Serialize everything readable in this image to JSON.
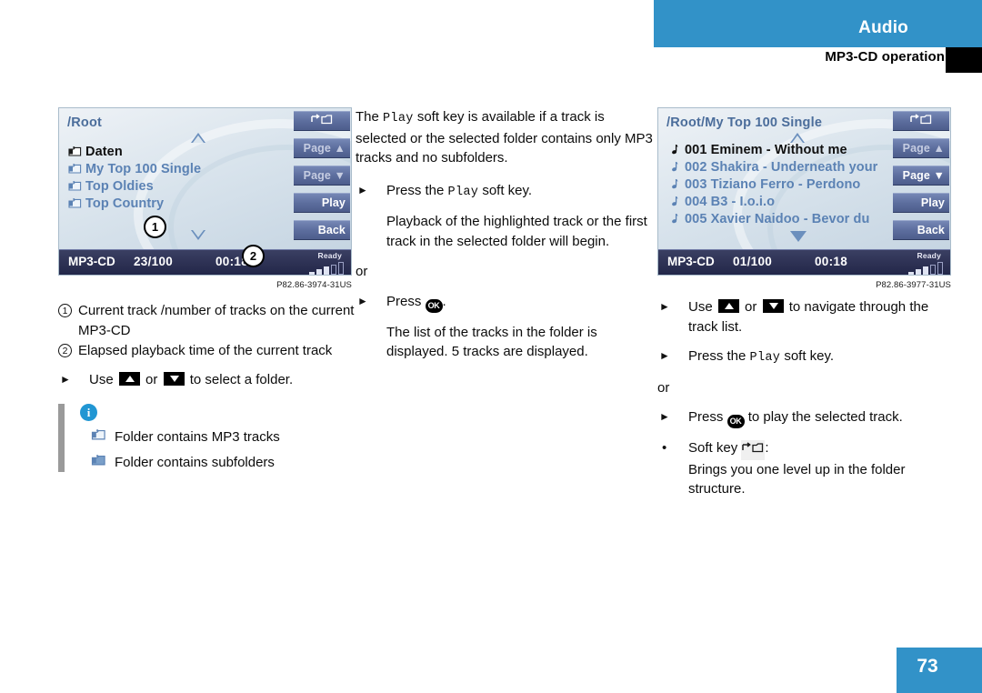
{
  "header": {
    "section": "Audio",
    "subtitle": "MP3-CD operation"
  },
  "footer": {
    "page_number": "73"
  },
  "colors": {
    "brand_blue": "#3292c8",
    "info_blue": "#2196d3",
    "screen_text_blue": "#5b82b4",
    "softkey_blue": "#5d6e9e",
    "statusbar_dark": "#2c3052",
    "note_bar_gray": "#9a9a9a"
  },
  "left_screen": {
    "title": "/Root",
    "scroll_up_icon": "triangle-up-outline-icon",
    "scroll_down_icon": "triangle-down-outline-icon",
    "items": [
      {
        "icon": "folder-mp3-icon",
        "label": "Daten",
        "selected": true
      },
      {
        "icon": "folder-mp3-icon",
        "label": "My Top 100 Single",
        "selected": false
      },
      {
        "icon": "folder-mp3-icon",
        "label": "Top Oldies",
        "selected": false
      },
      {
        "icon": "folder-mp3-icon",
        "label": "Top Country",
        "selected": false
      }
    ],
    "softkeys": [
      {
        "label": "",
        "icon": "folder-up-icon",
        "dim": false
      },
      {
        "label": "Page ▲",
        "icon": "",
        "dim": true
      },
      {
        "label": "Page ▼",
        "icon": "",
        "dim": true
      },
      {
        "label": "Play",
        "icon": "",
        "dim": false
      },
      {
        "label": "Back",
        "icon": "",
        "dim": false
      }
    ],
    "status": {
      "source": "MP3-CD",
      "track": "23/100",
      "time": "00:18",
      "ready": "Ready"
    },
    "callouts": [
      "1",
      "2"
    ],
    "figure_id": "P82.86-3974-31US"
  },
  "right_screen": {
    "title": "/Root/My Top 100 Single",
    "scroll_up_icon": "triangle-up-outline-icon",
    "scroll_down_icon": "triangle-down-filled-icon",
    "items": [
      {
        "icon": "music-note-icon",
        "label": "001 Eminem - Without me",
        "selected": true
      },
      {
        "icon": "music-note-icon",
        "label": "002 Shakira - Underneath your",
        "selected": false
      },
      {
        "icon": "music-note-icon",
        "label": "003 Tiziano Ferro - Perdono",
        "selected": false
      },
      {
        "icon": "music-note-icon",
        "label": "004 B3 - I.o.i.o",
        "selected": false
      },
      {
        "icon": "music-note-icon",
        "label": "005 Xavier Naidoo - Bevor du",
        "selected": false
      }
    ],
    "softkeys": [
      {
        "label": "",
        "icon": "folder-up-icon",
        "dim": false
      },
      {
        "label": "Page ▲",
        "icon": "",
        "dim": true
      },
      {
        "label": "Page ▼",
        "icon": "",
        "dim": false
      },
      {
        "label": "Play",
        "icon": "",
        "dim": false
      },
      {
        "label": "Back",
        "icon": "",
        "dim": false
      }
    ],
    "status": {
      "source": "MP3-CD",
      "track": "01/100",
      "time": "00:18",
      "ready": "Ready"
    },
    "figure_id": "P82.86-3977-31US"
  },
  "left_column": {
    "legend": [
      {
        "num": "1",
        "text": "Current track /number of tracks on the current MP3-CD"
      },
      {
        "num": "2",
        "text": "Elapsed playback time of the current track"
      }
    ],
    "step_use_pre": "Use",
    "step_use_mid": "or",
    "step_use_post": "to select a folder.",
    "note": {
      "icon": "info-icon",
      "rows": [
        {
          "icon": "folder-mp3-icon",
          "text": "Folder contains MP3 tracks"
        },
        {
          "icon": "folder-subfolder-icon",
          "text": "Folder contains subfolders"
        }
      ]
    }
  },
  "middle_column": {
    "intro_pre": "The",
    "intro_key": "Play",
    "intro_post": "soft key is available if a track is selected or the selected folder contains only MP3 tracks and no subfolders.",
    "step1_pre": "Press the",
    "step1_key": "Play",
    "step1_post": "soft key.",
    "step1_result": "Playback of the highlighted track or the first track in the selected folder will begin.",
    "or": "or",
    "step2_pre": "Press",
    "step2_key": "OK",
    "step2_post": ".",
    "step2_result": "The list of the tracks in the folder is displayed. 5 tracks are displayed."
  },
  "right_column": {
    "step1_pre": "Use",
    "step1_mid": "or",
    "step1_post": "to navigate through the track list.",
    "step2_pre": "Press the",
    "step2_key": "Play",
    "step2_post": "soft key.",
    "or": "or",
    "step3_pre": "Press",
    "step3_key": "OK",
    "step3_post": "to play the selected track.",
    "bullet_pre": "Soft key",
    "bullet_icon": "folder-up-icon",
    "bullet_colon": ":",
    "bullet_text": "Brings you one level up in the folder structure."
  }
}
